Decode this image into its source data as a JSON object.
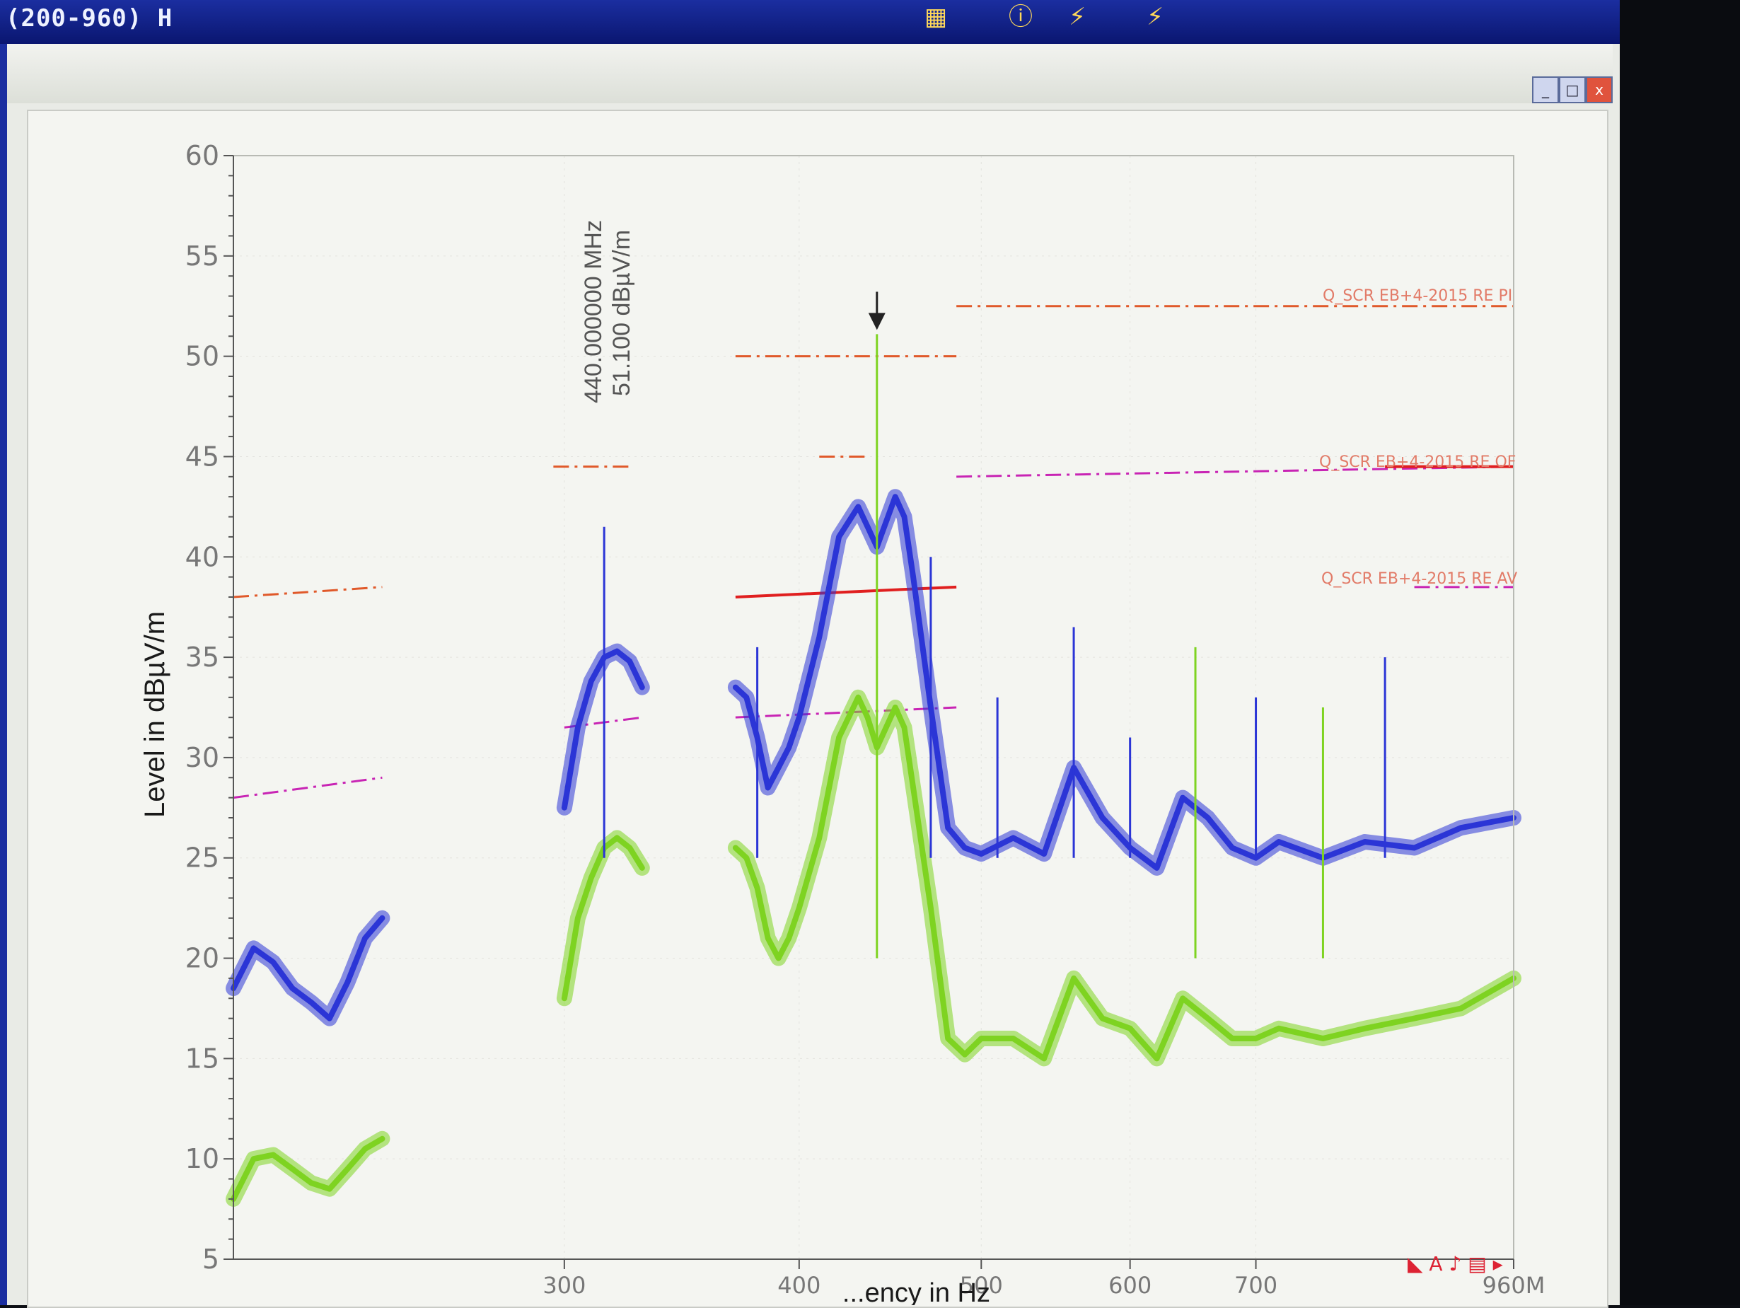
{
  "window": {
    "title": "(200-960) H",
    "toolbar_icons": [
      "image-icon",
      "info-icon",
      "a1-icon",
      "a2-icon"
    ],
    "buttons": {
      "minimize": "_",
      "maximize": "□",
      "close": "x"
    }
  },
  "colors": {
    "blue_trace": "#2b35d6",
    "green_trace": "#7ed321",
    "limit_orange": "#e0592a",
    "limit_magenta": "#c824b4",
    "limit_red": "#e01f1f"
  },
  "marker": {
    "frequency_label": "440.000000 MHz",
    "level_label": "51.100 dBµV/m",
    "x": 440,
    "y": 51.1
  },
  "chart_data": {
    "type": "line",
    "title": "",
    "xlabel": "...ency in Hz",
    "ylabel": "Level in dBµV/m",
    "xscale": "log",
    "xlim": [
      200,
      960
    ],
    "ylim": [
      5,
      60
    ],
    "y_ticks": [
      5,
      10,
      15,
      20,
      25,
      30,
      35,
      40,
      45,
      50,
      55,
      60
    ],
    "x_ticks": [
      {
        "value": 300,
        "label": "300"
      },
      {
        "value": 400,
        "label": "400"
      },
      {
        "value": 500,
        "label": "500"
      },
      {
        "value": 600,
        "label": "600"
      },
      {
        "value": 700,
        "label": "700"
      },
      {
        "value": 960,
        "label": "960M"
      }
    ],
    "grid": "on",
    "series": [
      {
        "color": "#2b35d6",
        "segments": [
          {
            "x": [
              200,
              205,
              210,
              215,
              220,
              225,
              230,
              235,
              240
            ],
            "y": [
              18.5,
              20.5,
              19.8,
              18.5,
              17.8,
              17.0,
              18.8,
              21.0,
              22.0
            ]
          },
          {
            "x": [
              300,
              305,
              310,
              315,
              320,
              325,
              330
            ],
            "y": [
              27.5,
              31.5,
              33.8,
              35.0,
              35.3,
              34.8,
              33.5
            ]
          },
          {
            "x": [
              370,
              375,
              380,
              385,
              390,
              395,
              400,
              410,
              420,
              430,
              435,
              440,
              450,
              455,
              460,
              470,
              480,
              490,
              500,
              520,
              540,
              560,
              580,
              600,
              620,
              640,
              660,
              680,
              700,
              720,
              760,
              800,
              850,
              900,
              960
            ],
            "y": [
              33.5,
              33.0,
              31.0,
              28.5,
              29.5,
              30.5,
              32.0,
              36.0,
              41.0,
              42.5,
              41.5,
              40.5,
              43.0,
              42.0,
              39.0,
              32.5,
              26.5,
              25.5,
              25.2,
              26.0,
              25.2,
              29.5,
              27.0,
              25.5,
              24.5,
              28.0,
              27.0,
              25.5,
              25.0,
              25.8,
              25.0,
              25.8,
              25.5,
              26.5,
              27.0
            ]
          }
        ]
      },
      {
        "color": "#7ed321",
        "segments": [
          {
            "x": [
              200,
              205,
              210,
              215,
              220,
              225,
              230,
              235,
              240
            ],
            "y": [
              8.0,
              10.0,
              10.2,
              9.5,
              8.8,
              8.5,
              9.5,
              10.5,
              11.0
            ]
          },
          {
            "x": [
              300,
              305,
              310,
              315,
              320,
              325,
              330
            ],
            "y": [
              18.0,
              22.0,
              24.0,
              25.5,
              26.0,
              25.5,
              24.5
            ]
          },
          {
            "x": [
              370,
              375,
              380,
              385,
              390,
              395,
              400,
              410,
              420,
              430,
              435,
              440,
              450,
              455,
              460,
              470,
              480,
              490,
              500,
              520,
              540,
              560,
              580,
              600,
              620,
              640,
              660,
              680,
              700,
              720,
              760,
              800,
              850,
              900,
              960
            ],
            "y": [
              25.5,
              25.0,
              23.5,
              21.0,
              20.0,
              21.0,
              22.5,
              26.0,
              31.0,
              33.0,
              32.0,
              30.5,
              32.5,
              31.5,
              28.5,
              22.5,
              16.0,
              15.2,
              16.0,
              16.0,
              15.0,
              19.0,
              17.0,
              16.5,
              15.0,
              18.0,
              17.0,
              16.0,
              16.0,
              16.5,
              16.0,
              16.5,
              17.0,
              17.5,
              19.0
            ]
          }
        ]
      }
    ],
    "spikes": [
      {
        "x": 315,
        "top": 41.5,
        "color": "#2b35d6"
      },
      {
        "x": 380,
        "top": 35.5,
        "color": "#2b35d6"
      },
      {
        "x": 440,
        "top": 51.1,
        "color": "#7ed321"
      },
      {
        "x": 470,
        "top": 40.0,
        "color": "#2b35d6"
      },
      {
        "x": 510,
        "top": 33.0,
        "color": "#2b35d6"
      },
      {
        "x": 560,
        "top": 36.5,
        "color": "#2b35d6"
      },
      {
        "x": 600,
        "top": 31.0,
        "color": "#2b35d6"
      },
      {
        "x": 650,
        "top": 35.5,
        "color": "#7ed321"
      },
      {
        "x": 700,
        "top": 33.0,
        "color": "#2b35d6"
      },
      {
        "x": 760,
        "top": 32.5,
        "color": "#7ed321"
      },
      {
        "x": 820,
        "top": 35.0,
        "color": "#2b35d6"
      }
    ],
    "limit_lines": [
      {
        "x": [
          200,
          240
        ],
        "y": [
          38.0,
          38.5
        ],
        "color": "#e0592a",
        "style": "dashdot"
      },
      {
        "x": [
          200,
          240
        ],
        "y": [
          28.0,
          29.0
        ],
        "color": "#c824b4",
        "style": "dashdot"
      },
      {
        "x": [
          296,
          325
        ],
        "y": [
          44.5,
          44.5
        ],
        "color": "#e0592a",
        "style": "dashdot"
      },
      {
        "x": [
          300,
          330
        ],
        "y": [
          31.5,
          32.0
        ],
        "color": "#c824b4",
        "style": "dashdot"
      },
      {
        "x": [
          370,
          485
        ],
        "y": [
          50.0,
          50.0
        ],
        "color": "#e0592a",
        "style": "dashdot"
      },
      {
        "x": [
          410,
          435
        ],
        "y": [
          45.0,
          45.0
        ],
        "color": "#e0592a",
        "style": "dashdot"
      },
      {
        "x": [
          370,
          485
        ],
        "y": [
          38.0,
          38.5
        ],
        "color": "#e01f1f",
        "style": "solid"
      },
      {
        "x": [
          370,
          485
        ],
        "y": [
          32.0,
          32.5
        ],
        "color": "#c824b4",
        "style": "dashdot"
      },
      {
        "x": [
          485,
          960
        ],
        "y": [
          52.5,
          52.5
        ],
        "color": "#e0592a",
        "style": "dashdot"
      },
      {
        "x": [
          485,
          960
        ],
        "y": [
          44.0,
          44.5
        ],
        "color": "#c824b4",
        "style": "dashdot"
      },
      {
        "x": [
          820,
          960
        ],
        "y": [
          44.5,
          44.5
        ],
        "color": "#e01f1f",
        "style": "solid"
      },
      {
        "x": [
          850,
          960
        ],
        "y": [
          38.5,
          38.5
        ],
        "color": "#c824b4",
        "style": "dashdot"
      }
    ],
    "limit_labels": [
      "Q_SCR EB+4-2015 RE PI",
      "Q_SCR EB+4-2015 RE OF",
      "Q_SCR EB+4-2015 RE AV"
    ]
  }
}
